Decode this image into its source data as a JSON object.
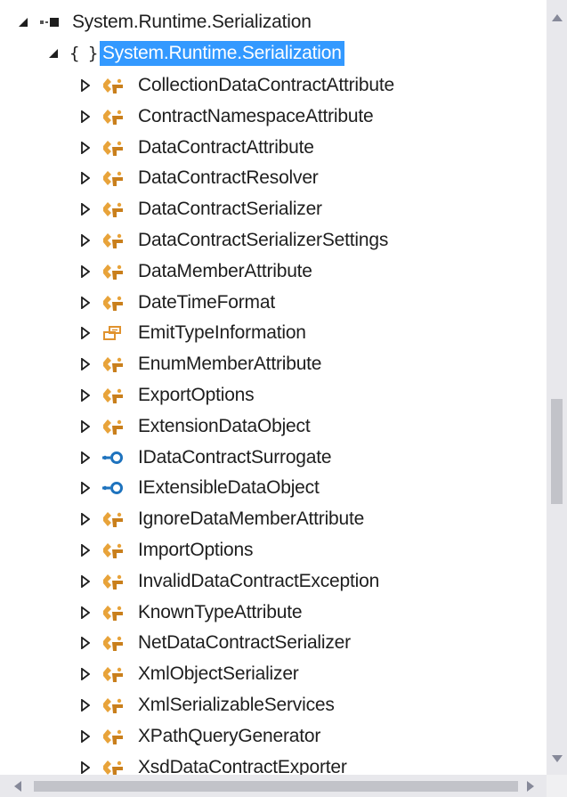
{
  "assembly": {
    "label": "System.Runtime.Serialization",
    "icon": "assembly-icon"
  },
  "namespace": {
    "label": "System.Runtime.Serialization",
    "icon": "namespace-braces-icon",
    "glyph": "{ }"
  },
  "types": [
    {
      "label": "CollectionDataContractAttribute",
      "icon": "class-icon"
    },
    {
      "label": "ContractNamespaceAttribute",
      "icon": "class-icon"
    },
    {
      "label": "DataContractAttribute",
      "icon": "class-icon"
    },
    {
      "label": "DataContractResolver",
      "icon": "class-icon"
    },
    {
      "label": "DataContractSerializer",
      "icon": "class-icon"
    },
    {
      "label": "DataContractSerializerSettings",
      "icon": "class-icon"
    },
    {
      "label": "DataMemberAttribute",
      "icon": "class-icon"
    },
    {
      "label": "DateTimeFormat",
      "icon": "class-icon"
    },
    {
      "label": "EmitTypeInformation",
      "icon": "enum-icon"
    },
    {
      "label": "EnumMemberAttribute",
      "icon": "class-icon"
    },
    {
      "label": "ExportOptions",
      "icon": "class-icon"
    },
    {
      "label": "ExtensionDataObject",
      "icon": "class-icon"
    },
    {
      "label": "IDataContractSurrogate",
      "icon": "interface-icon"
    },
    {
      "label": "IExtensibleDataObject",
      "icon": "interface-icon"
    },
    {
      "label": "IgnoreDataMemberAttribute",
      "icon": "class-icon"
    },
    {
      "label": "ImportOptions",
      "icon": "class-icon"
    },
    {
      "label": "InvalidDataContractException",
      "icon": "class-icon"
    },
    {
      "label": "KnownTypeAttribute",
      "icon": "class-icon"
    },
    {
      "label": "NetDataContractSerializer",
      "icon": "class-icon"
    },
    {
      "label": "XmlObjectSerializer",
      "icon": "class-icon"
    },
    {
      "label": "XmlSerializableServices",
      "icon": "class-icon"
    },
    {
      "label": "XPathQueryGenerator",
      "icon": "class-icon"
    },
    {
      "label": "XsdDataContractExporter",
      "icon": "class-icon"
    }
  ],
  "colors": {
    "selection": "#3399ff",
    "class_icon": "#e8a33a",
    "interface_icon": "#1e73be",
    "scrollbar_track": "#e8e8ec",
    "scrollbar_thumb": "#c2c3c9"
  }
}
